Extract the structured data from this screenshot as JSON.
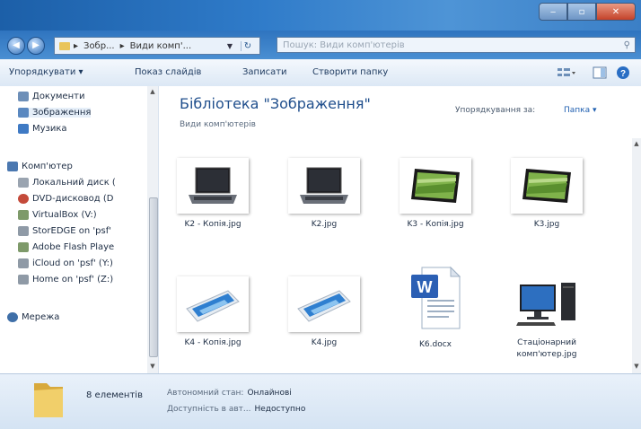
{
  "window": {
    "minimize_glyph": "‒",
    "maximize_glyph": "▫",
    "close_glyph": "✕"
  },
  "address": {
    "segments": [
      "Зобр...",
      "Види комп'..."
    ],
    "separator": "▸",
    "search_placeholder": "Пошук: Види комп'ютерів"
  },
  "toolbar": {
    "organize": "Упорядкувати ▾",
    "slideshow": "Показ слайдів",
    "burn": "Записати",
    "new_folder": "Створити папку"
  },
  "nav": {
    "items": [
      {
        "label": "Документи",
        "icon": "documents-icon",
        "color": "#6d8fb8"
      },
      {
        "label": "Зображення",
        "icon": "pictures-icon",
        "color": "#5a88c0",
        "selected": true
      },
      {
        "label": "Музика",
        "icon": "music-icon",
        "color": "#3f7ac4"
      },
      {
        "label": "Комп'ютер",
        "icon": "computer-icon",
        "color": "#4b78b0"
      },
      {
        "label": "Локальний диск (",
        "icon": "local-disk-icon",
        "color": "#9aa4b0"
      },
      {
        "label": "DVD-дисковод (D",
        "icon": "dvd-drive-icon",
        "color": "#c44a3a"
      },
      {
        "label": "VirtualBox (V:)",
        "icon": "network-drive-icon",
        "color": "#7e9a6a"
      },
      {
        "label": "StorEDGE on 'psf'",
        "icon": "network-share-icon",
        "color": "#8f9aa6"
      },
      {
        "label": "Adobe Flash Playe",
        "icon": "network-drive-icon",
        "color": "#7e9a6a"
      },
      {
        "label": "iCloud on 'psf' (Y:)",
        "icon": "network-share-icon",
        "color": "#8f9aa6"
      },
      {
        "label": "Home on 'psf' (Z:)",
        "icon": "network-share-icon",
        "color": "#8f9aa6"
      },
      {
        "label": "Мережа",
        "icon": "network-icon",
        "color": "#3f6fa8"
      }
    ]
  },
  "content": {
    "title": "Бібліотека \"Зображення\"",
    "subtitle": "Види комп'ютерів",
    "arrange_label": "Упорядкування за:",
    "arrange_value": "Папка ▾",
    "files": [
      {
        "name": "K2 - Копія.jpg",
        "kind": "laptop"
      },
      {
        "name": "K2.jpg",
        "kind": "laptop"
      },
      {
        "name": "K3 - Копія.jpg",
        "kind": "tablet"
      },
      {
        "name": "K3.jpg",
        "kind": "tablet"
      },
      {
        "name": "K4 - Копія.jpg",
        "kind": "phone"
      },
      {
        "name": "K4.jpg",
        "kind": "phone"
      },
      {
        "name": "K6.docx",
        "kind": "word"
      },
      {
        "name": "Стаціонарний комп'ютер.jpg",
        "kind": "desktop"
      }
    ]
  },
  "status": {
    "count": "8 елементів",
    "offline_label": "Автономний стан:",
    "offline_value": "Онлайнові",
    "availability_label": "Доступність в авт...",
    "availability_value": "Недоступно"
  }
}
